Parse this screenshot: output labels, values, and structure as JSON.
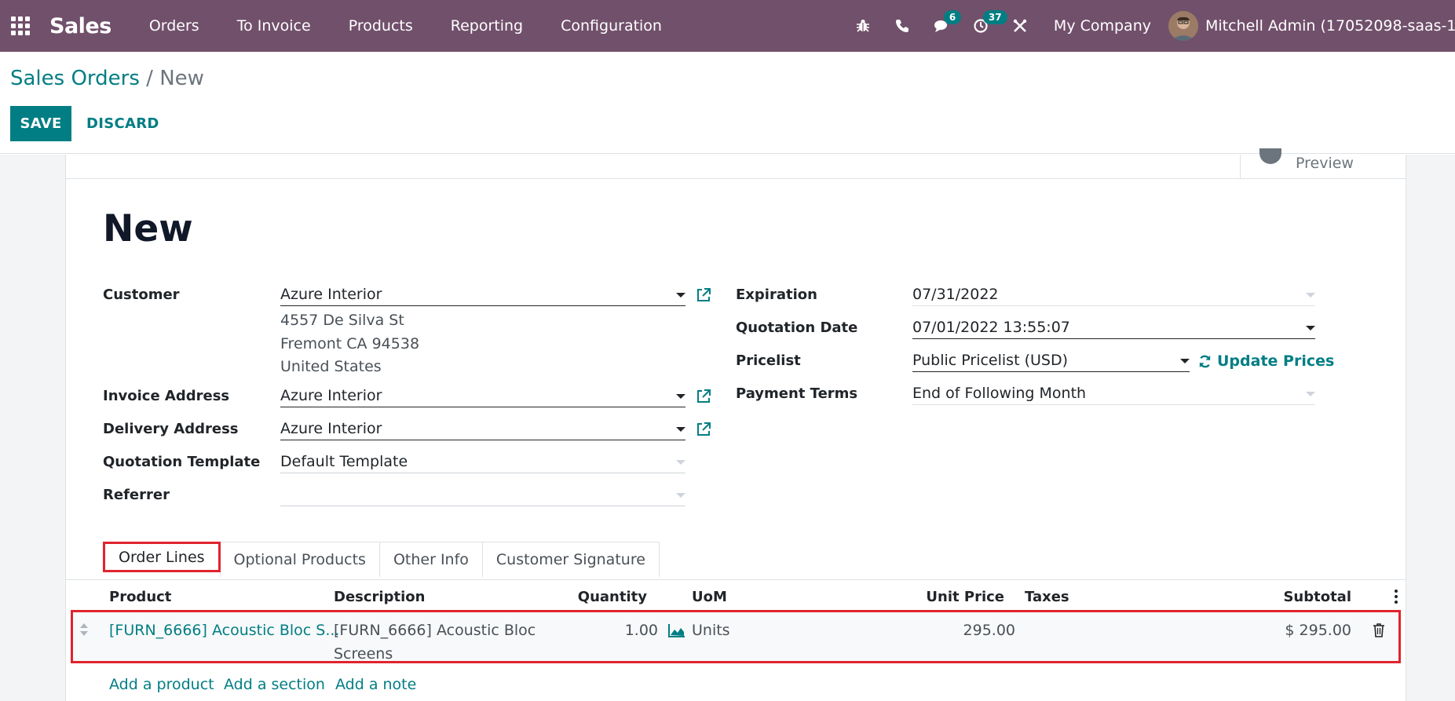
{
  "navbar": {
    "app_name": "Sales",
    "menu": [
      "Orders",
      "To Invoice",
      "Products",
      "Reporting",
      "Configuration"
    ],
    "discuss_badge": "6",
    "activity_badge": "37",
    "company": "My Company",
    "user": "Mitchell Admin (17052098-saas-15-1"
  },
  "breadcrumb": {
    "parent": "Sales Orders",
    "separator": " / ",
    "current": "New"
  },
  "actions": {
    "save": "SAVE",
    "discard": "DISCARD"
  },
  "preview": {
    "label": "Preview"
  },
  "record": {
    "title": "New"
  },
  "left_fields": {
    "customer_label": "Customer",
    "customer_value": "Azure Interior",
    "address_line1": "4557 De Silva St",
    "address_line2": "Fremont CA 94538",
    "address_line3": "United States",
    "invoice_label": "Invoice Address",
    "invoice_value": "Azure Interior",
    "delivery_label": "Delivery Address",
    "delivery_value": "Azure Interior",
    "template_label": "Quotation Template",
    "template_value": "Default Template",
    "referrer_label": "Referrer",
    "referrer_value": ""
  },
  "right_fields": {
    "expiration_label": "Expiration",
    "expiration_value": "07/31/2022",
    "qdate_label": "Quotation Date",
    "qdate_value": "07/01/2022 13:55:07",
    "pricelist_label": "Pricelist",
    "pricelist_value": "Public Pricelist (USD)",
    "update_prices": "Update Prices",
    "terms_label": "Payment Terms",
    "terms_value": "End of Following Month"
  },
  "tabs": [
    "Order Lines",
    "Optional Products",
    "Other Info",
    "Customer Signature"
  ],
  "order_lines": {
    "headers": {
      "product": "Product",
      "description": "Description",
      "quantity": "Quantity",
      "uom": "UoM",
      "unit_price": "Unit Price",
      "taxes": "Taxes",
      "subtotal": "Subtotal"
    },
    "rows": [
      {
        "product": "[FURN_6666] Acoustic Bloc S...",
        "description_line1": "[FURN_6666] Acoustic Bloc",
        "description_line2": "Screens",
        "quantity": "1.00",
        "uom": "Units",
        "unit_price": "295.00",
        "taxes": "",
        "subtotal": "$ 295.00"
      }
    ],
    "add_product": "Add a product",
    "add_section": "Add a section",
    "add_note": "Add a note"
  },
  "colors": {
    "navbar": "#71506b",
    "primary": "#017e84",
    "highlight": "#e0242e"
  }
}
